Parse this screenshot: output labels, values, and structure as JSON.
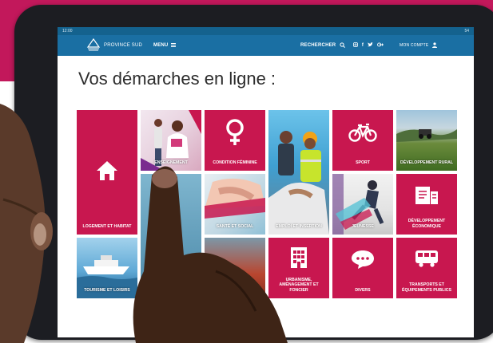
{
  "statusbar": {
    "time": "12:00",
    "right": "54"
  },
  "nav": {
    "brand": "PROVINCE SUD",
    "menu": "MENU",
    "search": "RECHERCHER",
    "social": "f",
    "account": "MON COMPTE"
  },
  "page_title": "Vos démarches en ligne :",
  "tiles": [
    {
      "label": "LOGEMENT ET HABITAT",
      "icon": "house-icon"
    },
    {
      "label": "ENSEIGNEMENT",
      "icon": "photo"
    },
    {
      "label": "CONDITION FÉMININE",
      "icon": "female-symbol-icon"
    },
    {
      "label": "EMPLOI ET INSERTION",
      "icon": "photo"
    },
    {
      "label": "SPORT",
      "icon": "bicycle-icon"
    },
    {
      "label": "DÉVELOPPEMENT RURAL",
      "icon": "photo"
    },
    {
      "label": "SANTÉ ET SOCIAL",
      "icon": "photo"
    },
    {
      "label": "JEUNESSE",
      "icon": "photo"
    },
    {
      "label": "DÉVELOPPEMENT ÉCONOMIQUE",
      "icon": "form-icon"
    },
    {
      "label": "TOURISME ET LOISIRS",
      "icon": "photo"
    },
    {
      "label": "URBANISME, AMÉNAGEMENT ET FONCIER",
      "icon": "building-icon"
    },
    {
      "label": "DIVERS",
      "icon": "chat-icon"
    },
    {
      "label": "TRANSPORTS ET ÉQUIPEMENTS PUBLICS",
      "icon": "bus-icon"
    }
  ],
  "colors": {
    "brand": "#c2185b",
    "tile": "#c8174f",
    "navbar": "#1a6fa3"
  }
}
